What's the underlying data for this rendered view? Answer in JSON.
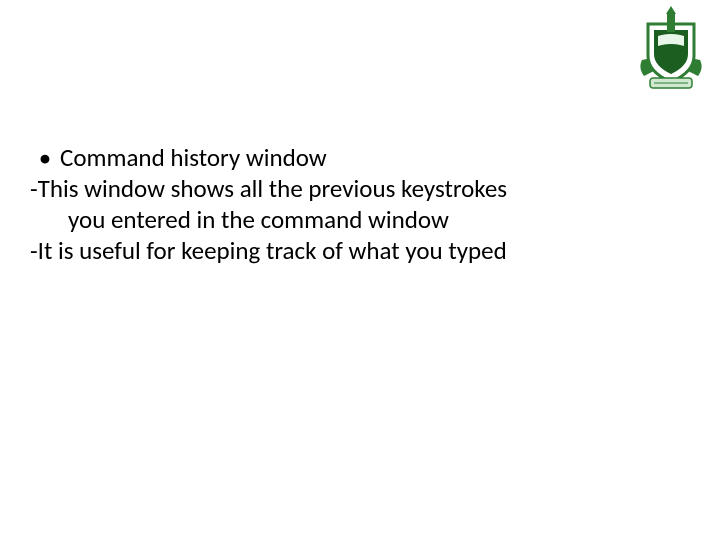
{
  "bullet": {
    "marker": "•",
    "text": "Command history window"
  },
  "lines": {
    "l2a": "-This window shows all the previous keystrokes",
    "l2b": "you entered in the command window",
    "l3": "-It is useful for keeping track of what you typed"
  },
  "logo": {
    "name": "university-crest-logo"
  }
}
